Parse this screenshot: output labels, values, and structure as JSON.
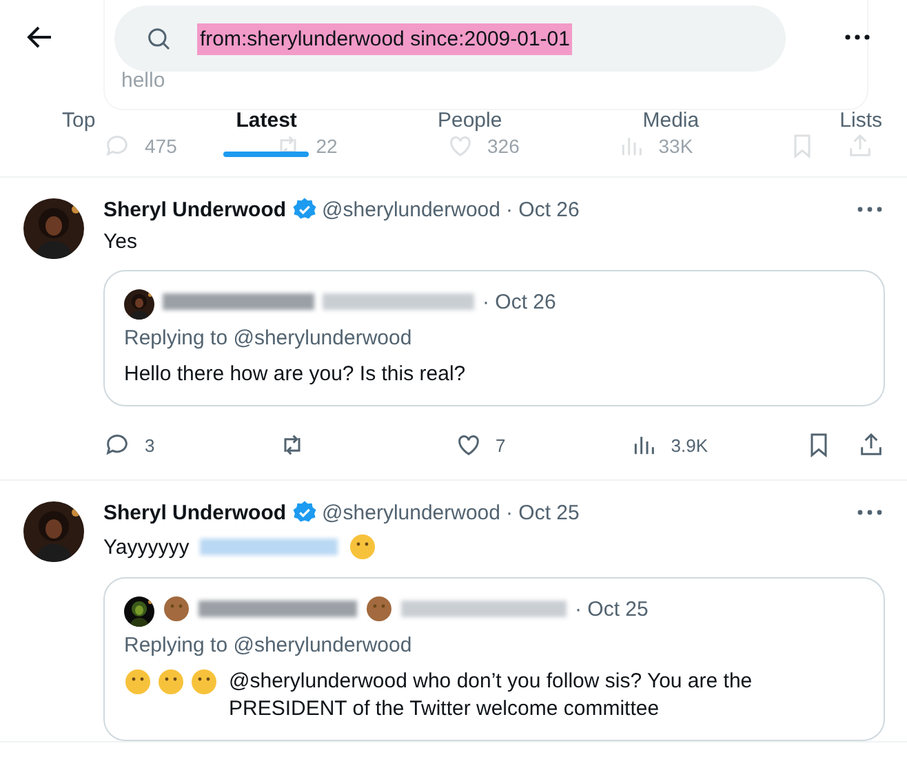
{
  "search": {
    "query": "from:sherylunderwood since:2009-01-01"
  },
  "background_tweet": {
    "text": "hello",
    "replies": "475",
    "reposts": "22",
    "likes": "326",
    "views": "33K"
  },
  "tabs": [
    {
      "label": "Top",
      "selected": false
    },
    {
      "label": "Latest",
      "selected": true
    },
    {
      "label": "People",
      "selected": false
    },
    {
      "label": "Media",
      "selected": false
    },
    {
      "label": "Lists",
      "selected": false
    }
  ],
  "tweets": [
    {
      "name": "Sheryl Underwood",
      "verified": true,
      "handle": "@sherylunderwood",
      "date": "· Oct 26",
      "text": "Yes",
      "blurred_mention": false,
      "emoji": false,
      "quote": {
        "date": "· Oct 26",
        "name_emojis": false,
        "replying": "Replying to @sherylunderwood",
        "reaction_emojis": false,
        "text": "Hello there how are you? Is this real?"
      },
      "replies": "3",
      "likes": "7",
      "views": "3.9K"
    },
    {
      "name": "Sheryl Underwood",
      "verified": true,
      "handle": "@sherylunderwood",
      "date": "· Oct 25",
      "text": "Yayyyyyy",
      "blurred_mention": true,
      "emoji": true,
      "quote": {
        "date": "· Oct 25",
        "name_emojis": true,
        "replying": "Replying to @sherylunderwood",
        "reaction_emojis": true,
        "text": "@sherylunderwood who don’t you follow sis? You are the PRESIDENT of the Twitter welcome committee"
      }
    }
  ]
}
